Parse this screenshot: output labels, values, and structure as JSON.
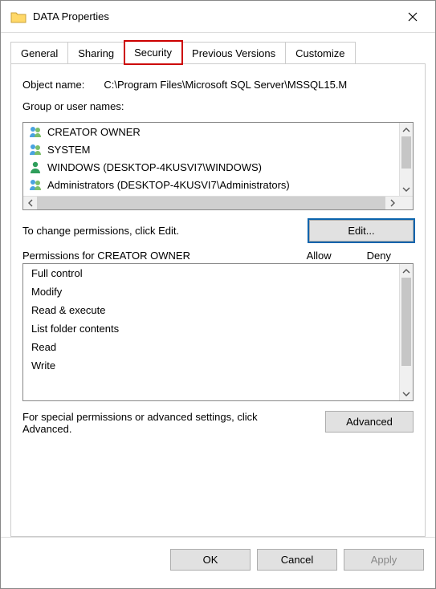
{
  "window": {
    "title": "DATA Properties"
  },
  "tabs": {
    "items": [
      {
        "label": "General"
      },
      {
        "label": "Sharing"
      },
      {
        "label": "Security"
      },
      {
        "label": "Previous Versions"
      },
      {
        "label": "Customize"
      }
    ]
  },
  "security": {
    "object_name_label": "Object name:",
    "object_name_value": "C:\\Program Files\\Microsoft SQL Server\\MSSQL15.M",
    "group_label": "Group or user names:",
    "groups": [
      {
        "icon": "group",
        "label": "CREATOR OWNER"
      },
      {
        "icon": "group",
        "label": "SYSTEM"
      },
      {
        "icon": "user",
        "label": "WINDOWS (DESKTOP-4KUSVI7\\WINDOWS)"
      },
      {
        "icon": "group",
        "label": "Administrators (DESKTOP-4KUSVI7\\Administrators)"
      }
    ],
    "edit_hint": "To change permissions, click Edit.",
    "edit_button": "Edit...",
    "perm_for_label": "Permissions for CREATOR OWNER",
    "allow_label": "Allow",
    "deny_label": "Deny",
    "permissions": [
      "Full control",
      "Modify",
      "Read & execute",
      "List folder contents",
      "Read",
      "Write"
    ],
    "advanced_hint": "For special permissions or advanced settings, click Advanced.",
    "advanced_button": "Advanced"
  },
  "buttons": {
    "ok": "OK",
    "cancel": "Cancel",
    "apply": "Apply"
  }
}
